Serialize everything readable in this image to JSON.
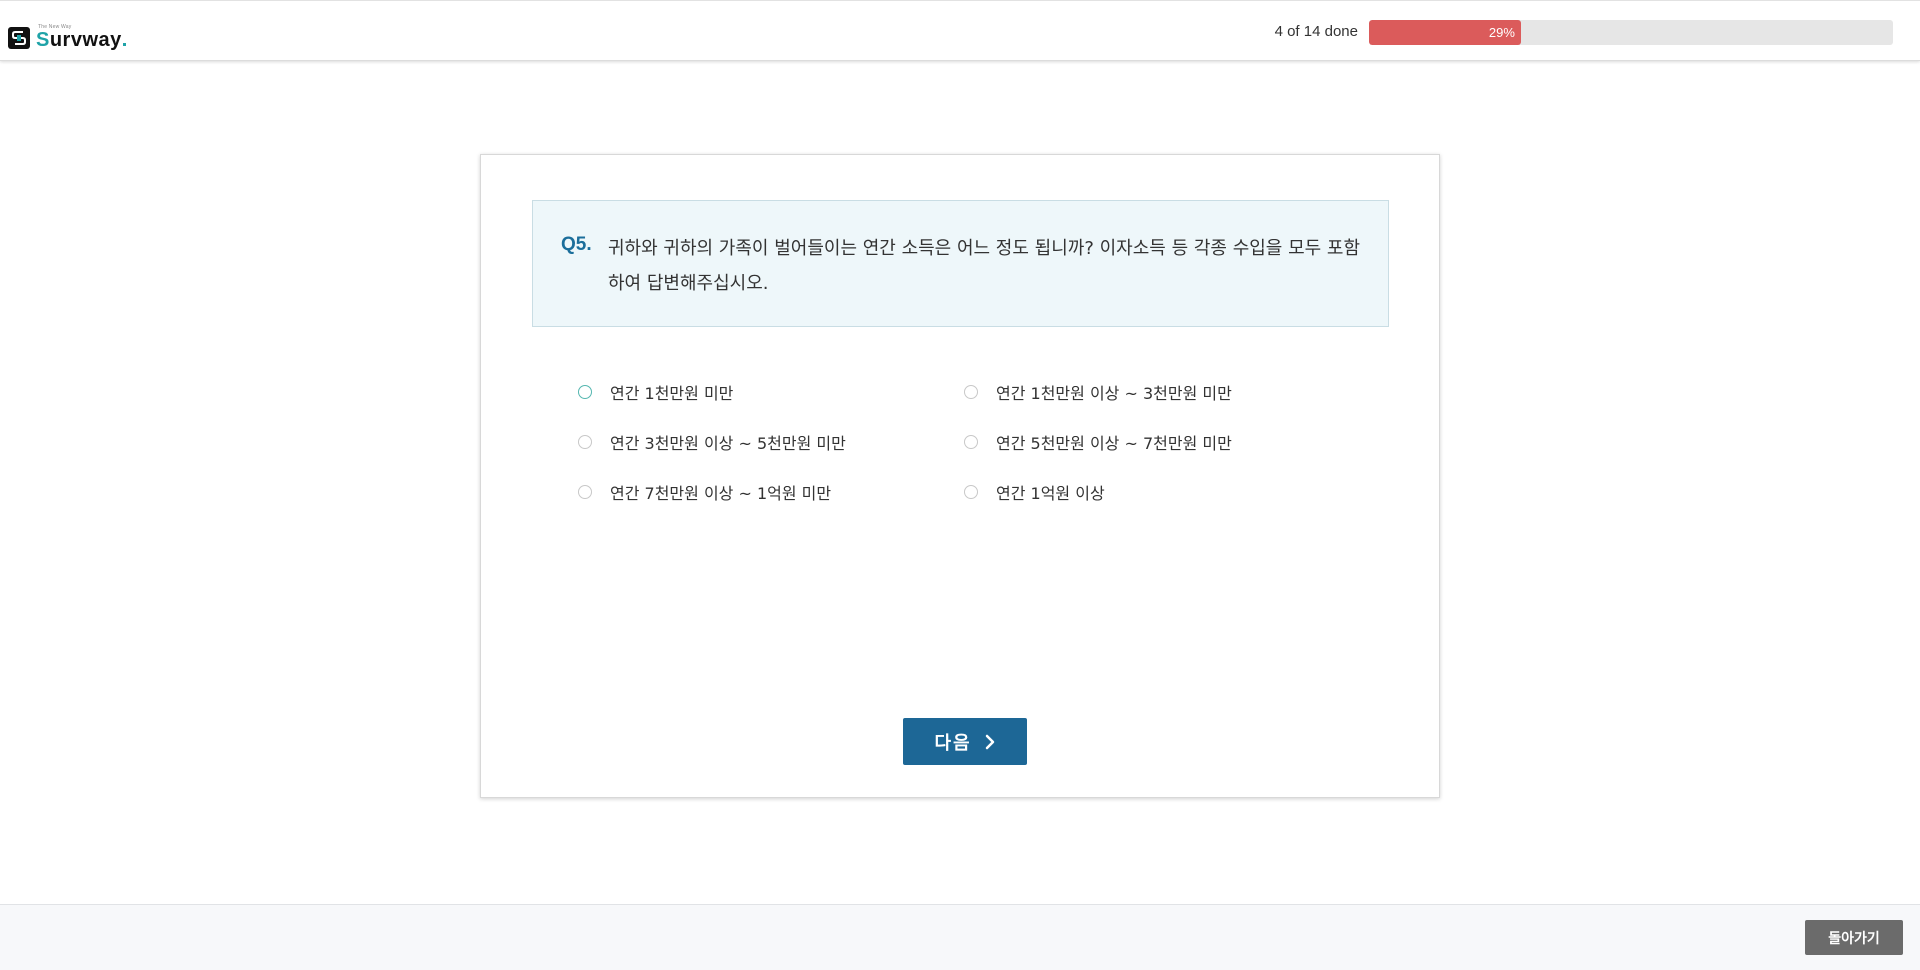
{
  "header": {
    "logo": {
      "tagline": "The New Way",
      "text_first": "S",
      "text_rest": "urvway",
      "icon": "survway-logo-icon"
    },
    "progress": {
      "label": "4 of 14 done",
      "percent_label": "29%",
      "fraction": 0.29
    }
  },
  "question": {
    "number": "Q5.",
    "text": "귀하와 귀하의 가족이 벌어들이는 연간 소득은 어느 정도 됩니까? 이자소득 등 각종 수입을 모두 포함하여 답변해주십시오.",
    "options": [
      "연간 1천만원 미만",
      "연간 1천만원 이상 ~ 3천만원 미만",
      "연간 3천만원 이상 ~ 5천만원 미만",
      "연간 5천만원 이상 ~ 7천만원 미만",
      "연간 7천만원 이상 ~ 1억원 미만",
      "연간 1억원 이상"
    ]
  },
  "actions": {
    "next_label": "다음",
    "next_icon": "chevron-right-icon",
    "back_label": "돌아가기"
  },
  "colors": {
    "progress_fill": "#db5b5b",
    "progress_track": "#e6e6e6",
    "primary_button": "#1d6796",
    "question_number": "#1b6e9b",
    "question_bg": "#eef7fa",
    "back_button": "#6b6b6b",
    "logo_accent": "#1fa3a8"
  }
}
